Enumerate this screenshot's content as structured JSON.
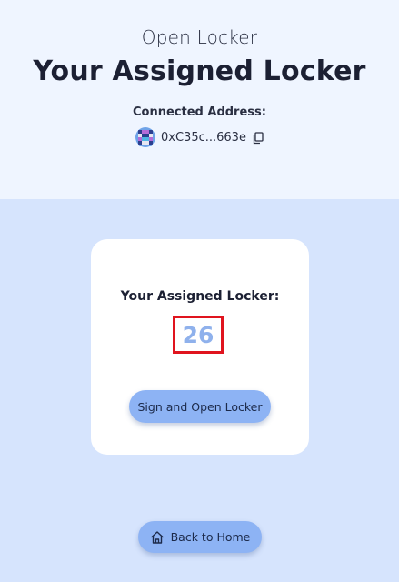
{
  "header": {
    "subtitle": "Open Locker",
    "title": "Your Assigned Locker",
    "connected_label": "Connected Address:",
    "address": "0xC35c...663e",
    "avatar_icon": "identicon-avatar",
    "copy_icon": "copy-icon"
  },
  "card": {
    "label": "Your Assigned Locker:",
    "locker_number": "26",
    "sign_button_label": "Sign and Open Locker"
  },
  "footer": {
    "home_button_label": "Back to Home",
    "home_icon": "home-icon"
  },
  "colors": {
    "header_bg": "#eff5ff",
    "page_bg": "#d6e4fd",
    "button_bg": "#8db3f4",
    "locker_number": "#8fb1ec",
    "highlight_border": "#e0141e"
  }
}
